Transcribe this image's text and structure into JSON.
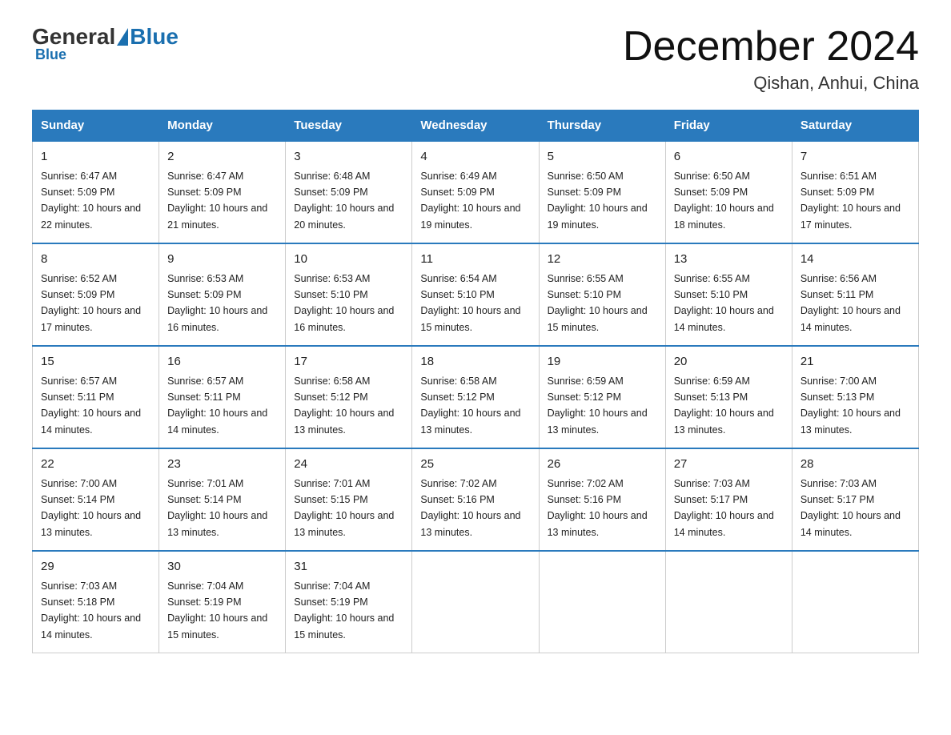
{
  "header": {
    "logo_general": "General",
    "logo_blue": "Blue",
    "title": "December 2024",
    "location": "Qishan, Anhui, China"
  },
  "days_of_week": [
    "Sunday",
    "Monday",
    "Tuesday",
    "Wednesday",
    "Thursday",
    "Friday",
    "Saturday"
  ],
  "weeks": [
    [
      {
        "num": "1",
        "sunrise": "6:47 AM",
        "sunset": "5:09 PM",
        "daylight": "10 hours and 22 minutes."
      },
      {
        "num": "2",
        "sunrise": "6:47 AM",
        "sunset": "5:09 PM",
        "daylight": "10 hours and 21 minutes."
      },
      {
        "num": "3",
        "sunrise": "6:48 AM",
        "sunset": "5:09 PM",
        "daylight": "10 hours and 20 minutes."
      },
      {
        "num": "4",
        "sunrise": "6:49 AM",
        "sunset": "5:09 PM",
        "daylight": "10 hours and 19 minutes."
      },
      {
        "num": "5",
        "sunrise": "6:50 AM",
        "sunset": "5:09 PM",
        "daylight": "10 hours and 19 minutes."
      },
      {
        "num": "6",
        "sunrise": "6:50 AM",
        "sunset": "5:09 PM",
        "daylight": "10 hours and 18 minutes."
      },
      {
        "num": "7",
        "sunrise": "6:51 AM",
        "sunset": "5:09 PM",
        "daylight": "10 hours and 17 minutes."
      }
    ],
    [
      {
        "num": "8",
        "sunrise": "6:52 AM",
        "sunset": "5:09 PM",
        "daylight": "10 hours and 17 minutes."
      },
      {
        "num": "9",
        "sunrise": "6:53 AM",
        "sunset": "5:09 PM",
        "daylight": "10 hours and 16 minutes."
      },
      {
        "num": "10",
        "sunrise": "6:53 AM",
        "sunset": "5:10 PM",
        "daylight": "10 hours and 16 minutes."
      },
      {
        "num": "11",
        "sunrise": "6:54 AM",
        "sunset": "5:10 PM",
        "daylight": "10 hours and 15 minutes."
      },
      {
        "num": "12",
        "sunrise": "6:55 AM",
        "sunset": "5:10 PM",
        "daylight": "10 hours and 15 minutes."
      },
      {
        "num": "13",
        "sunrise": "6:55 AM",
        "sunset": "5:10 PM",
        "daylight": "10 hours and 14 minutes."
      },
      {
        "num": "14",
        "sunrise": "6:56 AM",
        "sunset": "5:11 PM",
        "daylight": "10 hours and 14 minutes."
      }
    ],
    [
      {
        "num": "15",
        "sunrise": "6:57 AM",
        "sunset": "5:11 PM",
        "daylight": "10 hours and 14 minutes."
      },
      {
        "num": "16",
        "sunrise": "6:57 AM",
        "sunset": "5:11 PM",
        "daylight": "10 hours and 14 minutes."
      },
      {
        "num": "17",
        "sunrise": "6:58 AM",
        "sunset": "5:12 PM",
        "daylight": "10 hours and 13 minutes."
      },
      {
        "num": "18",
        "sunrise": "6:58 AM",
        "sunset": "5:12 PM",
        "daylight": "10 hours and 13 minutes."
      },
      {
        "num": "19",
        "sunrise": "6:59 AM",
        "sunset": "5:12 PM",
        "daylight": "10 hours and 13 minutes."
      },
      {
        "num": "20",
        "sunrise": "6:59 AM",
        "sunset": "5:13 PM",
        "daylight": "10 hours and 13 minutes."
      },
      {
        "num": "21",
        "sunrise": "7:00 AM",
        "sunset": "5:13 PM",
        "daylight": "10 hours and 13 minutes."
      }
    ],
    [
      {
        "num": "22",
        "sunrise": "7:00 AM",
        "sunset": "5:14 PM",
        "daylight": "10 hours and 13 minutes."
      },
      {
        "num": "23",
        "sunrise": "7:01 AM",
        "sunset": "5:14 PM",
        "daylight": "10 hours and 13 minutes."
      },
      {
        "num": "24",
        "sunrise": "7:01 AM",
        "sunset": "5:15 PM",
        "daylight": "10 hours and 13 minutes."
      },
      {
        "num": "25",
        "sunrise": "7:02 AM",
        "sunset": "5:16 PM",
        "daylight": "10 hours and 13 minutes."
      },
      {
        "num": "26",
        "sunrise": "7:02 AM",
        "sunset": "5:16 PM",
        "daylight": "10 hours and 13 minutes."
      },
      {
        "num": "27",
        "sunrise": "7:03 AM",
        "sunset": "5:17 PM",
        "daylight": "10 hours and 14 minutes."
      },
      {
        "num": "28",
        "sunrise": "7:03 AM",
        "sunset": "5:17 PM",
        "daylight": "10 hours and 14 minutes."
      }
    ],
    [
      {
        "num": "29",
        "sunrise": "7:03 AM",
        "sunset": "5:18 PM",
        "daylight": "10 hours and 14 minutes."
      },
      {
        "num": "30",
        "sunrise": "7:04 AM",
        "sunset": "5:19 PM",
        "daylight": "10 hours and 15 minutes."
      },
      {
        "num": "31",
        "sunrise": "7:04 AM",
        "sunset": "5:19 PM",
        "daylight": "10 hours and 15 minutes."
      },
      null,
      null,
      null,
      null
    ]
  ]
}
